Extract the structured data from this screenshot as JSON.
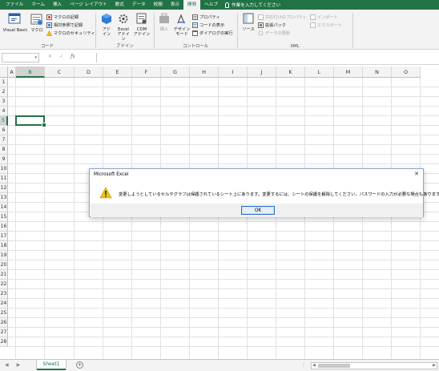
{
  "tabs": [
    {
      "label": "ファイル",
      "active": false
    },
    {
      "label": "ホーム",
      "active": false
    },
    {
      "label": "挿入",
      "active": false
    },
    {
      "label": "ページ レイアウト",
      "active": false
    },
    {
      "label": "数式",
      "active": false
    },
    {
      "label": "データ",
      "active": false
    },
    {
      "label": "校閲",
      "active": false
    },
    {
      "label": "表示",
      "active": false
    },
    {
      "label": "開発",
      "active": true
    },
    {
      "label": "ヘルプ",
      "active": false
    }
  ],
  "tell_me": "作業を入力してください",
  "ribbon": {
    "code": {
      "label": "コード",
      "visual_basic": "Visual Basic",
      "macro": "マクロ",
      "record_macro": "マクロの記録",
      "relative_ref": "相対参照で記録",
      "macro_security": "マクロのセキュリティ"
    },
    "addins": {
      "label": "アドイン",
      "addin_1": "アド",
      "addin_2": "イン",
      "excel_addin_1": "Excel",
      "excel_addin_2": "アドイン",
      "com_addin_1": "COM",
      "com_addin_2": "アドイン"
    },
    "controls": {
      "label": "コントロール",
      "insert": "挿入",
      "design_mode_1": "デザイン",
      "design_mode_2": "モード",
      "properties": "プロパティ",
      "view_code": "コードの表示",
      "run_dialog": "ダイアログの実行"
    },
    "xml": {
      "label": "XML",
      "source": "ソース",
      "map_properties": "対応付けのプロパティ",
      "expansion_packs": "拡張パック",
      "refresh_data": "データの更新",
      "import": "インポート",
      "export": "エクスポート"
    }
  },
  "formula_bar": {
    "cancel": "✕",
    "enter": "✓",
    "fx": "fx"
  },
  "columns": [
    "A",
    "B",
    "C",
    "D",
    "E",
    "F",
    "G",
    "H",
    "I",
    "J",
    "K",
    "L",
    "M",
    "N",
    "O"
  ],
  "rows": [
    "1",
    "2",
    "3",
    "4",
    "5",
    "6",
    "7",
    "8",
    "9",
    "10",
    "11",
    "12",
    "13",
    "14",
    "15",
    "16",
    "17",
    "18",
    "19",
    "20",
    "21",
    "22",
    "23",
    "24",
    "25",
    "26",
    "27",
    "28"
  ],
  "selected_column": "B",
  "selected_row": "5",
  "sheet_tab": "Sheet1",
  "dialog": {
    "title": "Microsoft Excel",
    "close": "✕",
    "message": "変更しようとしているセルやグラフは保護されているシート上にあります。変更するには、シートの保護を解除してください。パスワードの入力が必要な場合もあります。",
    "ok": "OK"
  },
  "colors": {
    "accent": "#217346",
    "warning": "#f2c40f"
  },
  "icons": {
    "warning": "warning-icon"
  }
}
